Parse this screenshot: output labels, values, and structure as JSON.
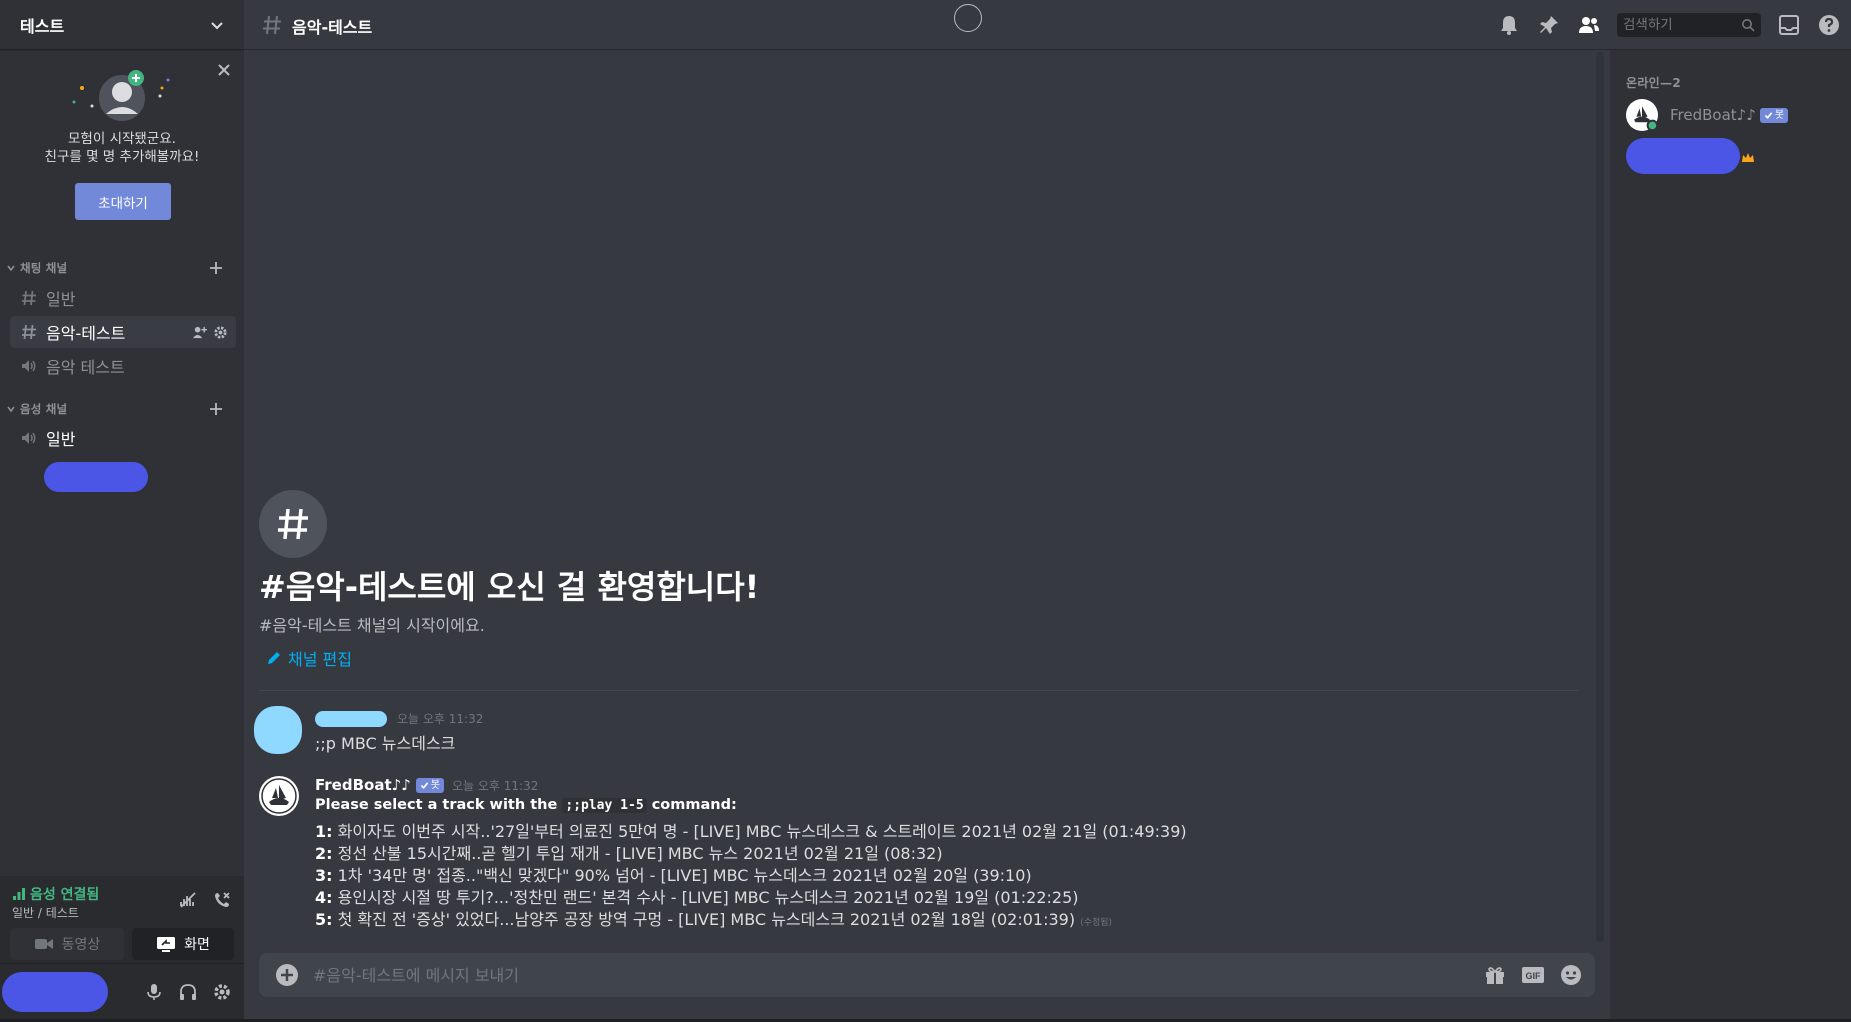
{
  "server": {
    "name": "테스트"
  },
  "welcome_card": {
    "line1": "모험이 시작됐군요.",
    "line2": "친구를 몇 명 추가해볼까요!",
    "invite_label": "초대하기"
  },
  "categories": {
    "text": "채팅 채널",
    "voice": "음성 채널"
  },
  "channels": [
    {
      "name": "일반",
      "type": "text"
    },
    {
      "name": "음악-테스트",
      "type": "text",
      "active": true
    },
    {
      "name": "음악 테스트",
      "type": "voice"
    }
  ],
  "voice_channels": [
    {
      "name": "일반",
      "type": "voice"
    }
  ],
  "voice_panel": {
    "status": "음성 연결됨",
    "sub": "일반 / 테스트",
    "video_label": "동영상",
    "screen_label": "화면"
  },
  "header": {
    "channel_title": "음악-테스트",
    "search_placeholder": "검색하기"
  },
  "channel_welcome": {
    "title": "#음악-테스트에 오신 걸 환영합니다!",
    "subtitle": "#음악-테스트 채널의 시작이에요.",
    "edit_label": "채널 편집"
  },
  "messages": [
    {
      "timestamp": "오늘 오후 11:32",
      "content": ";;p MBC 뉴스데스크"
    },
    {
      "author": "FredBoat♪♪",
      "bot_tag": "봇",
      "timestamp": "오늘 오후 11:32",
      "intro_prefix": "Please select a track with the ",
      "intro_code": ";;play 1-5",
      "intro_suffix": " command:",
      "tracks": [
        {
          "num": "1:",
          "text": " 화이자도 이번주 시작..'27일'부터 의료진 5만여 명 - [LIVE] MBC 뉴스데스크 & 스트레이트 2021년 02월 21일 (01:49:39)"
        },
        {
          "num": "2:",
          "text": " 정선 산불 15시간째..곧 헬기 투입 재개 - [LIVE] MBC 뉴스 2021년 02월 21일 (08:32)"
        },
        {
          "num": "3:",
          "text": " 1차 '34만 명' 접종..\"백신 맞겠다\" 90% 넘어 - [LIVE] MBC 뉴스데스크 2021년 02월 20일 (39:10)"
        },
        {
          "num": "4:",
          "text": " 용인시장 시절 땅 투기?...'정찬민 랜드' 본격 수사 - [LIVE] MBC 뉴스데스크 2021년 02월 19일 (01:22:25)"
        },
        {
          "num": "5:",
          "text": " 첫 확진 전 '증상' 있었다...남양주 공장 방역 구멍 - [LIVE] MBC 뉴스데스크 2021년 02월 18일 (02:01:39)"
        }
      ],
      "edited_label": "(수정됨)"
    }
  ],
  "composer": {
    "placeholder": "#음악-테스트에 메시지 보내기"
  },
  "members": {
    "category": "온라인—2",
    "list": [
      {
        "name": "FredBoat♪♪",
        "bot_tag": "봇"
      }
    ]
  },
  "colors": {
    "accent": "#7289da",
    "online": "#43b581",
    "link": "#00b0f4",
    "redaction": "#4c56e6",
    "redaction_light": "#8fd8ff"
  }
}
